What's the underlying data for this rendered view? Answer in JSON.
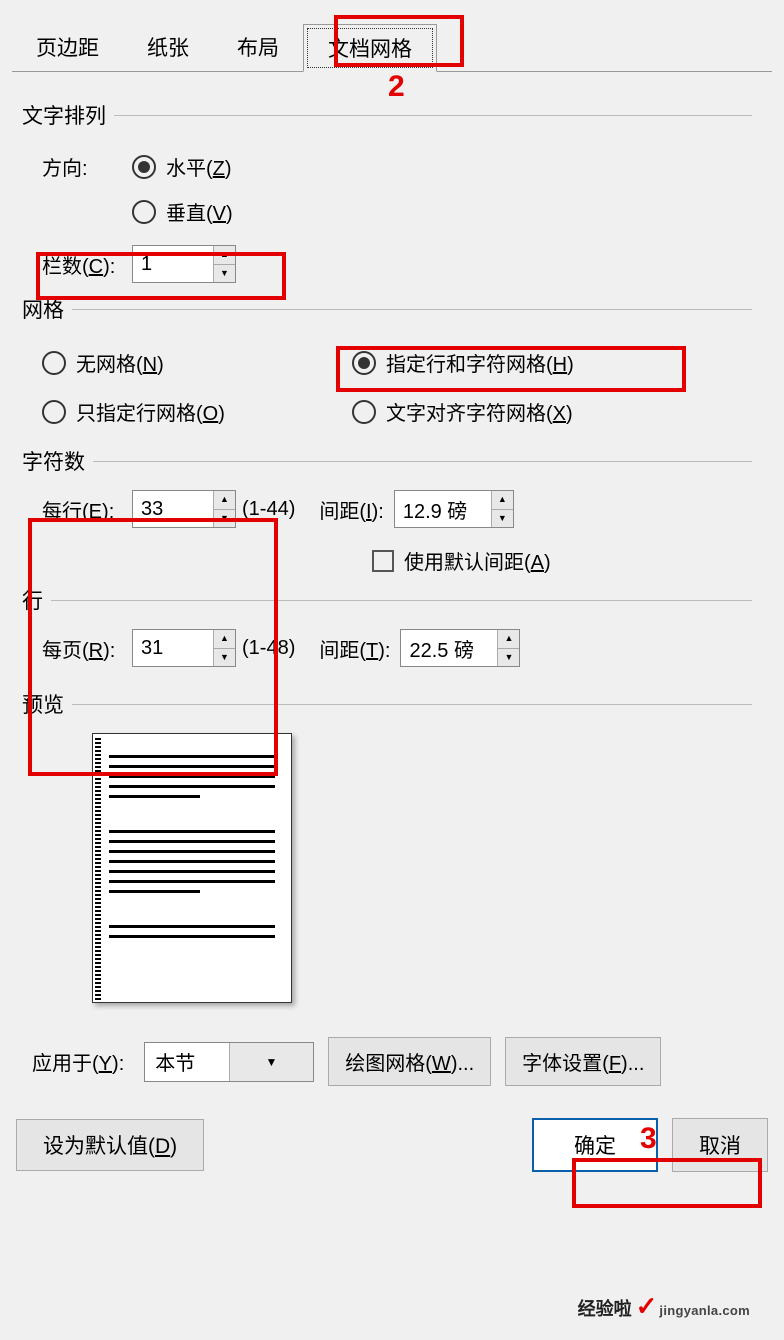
{
  "tabs": [
    "页边距",
    "纸张",
    "布局",
    "文档网格"
  ],
  "activeTab": 3,
  "textArrange": {
    "title": "文字排列",
    "directionLabel": "方向:",
    "horiz": "水平(",
    "horizKey": "Z",
    "vert": "垂直(",
    "vertKey": "V",
    "closeParen": ")",
    "colsLabel": "栏数(",
    "colsKey": "C",
    "colsValue": "1"
  },
  "grid": {
    "title": "网格",
    "noGrid": "无网格(",
    "noGridKey": "N",
    "lineChar": "指定行和字符网格(",
    "lineCharKey": "H",
    "lineOnly": "只指定行网格(",
    "lineOnlyKey": "O",
    "snapChar": "文字对齐字符网格(",
    "snapCharKey": "X"
  },
  "chars": {
    "title": "字符数",
    "perLine": "每行(",
    "perLineKey": "E",
    "perLineVal": "33",
    "perLineRange": "(1-44)",
    "pitchLabel": "间距(",
    "pitchKey": "I",
    "pitchVal": "12.9 磅",
    "defaultPitch": "使用默认间距(",
    "defaultPitchKey": "A"
  },
  "lines": {
    "title": "行",
    "perPage": "每页(",
    "perPageKey": "R",
    "perPageVal": "31",
    "perPageRange": "(1-48)",
    "pitchLabel": "间距(",
    "pitchKey": "T",
    "pitchVal": "22.5 磅"
  },
  "preview": {
    "title": "预览"
  },
  "apply": {
    "label": "应用于(",
    "key": "Y",
    "value": "本节",
    "drawGrid": "绘图网格(",
    "drawGridKey": "W",
    "ellipsis": ")...",
    "fontSet": "字体设置(",
    "fontSetKey": "F"
  },
  "footer": {
    "default": "设为默认值(",
    "defaultKey": "D",
    "ok": "确定",
    "cancel": "取消"
  },
  "annotations": {
    "num2": "2",
    "num3": "3"
  },
  "watermark": {
    "brand": "经验啦",
    "url": "jingyanla.com"
  }
}
